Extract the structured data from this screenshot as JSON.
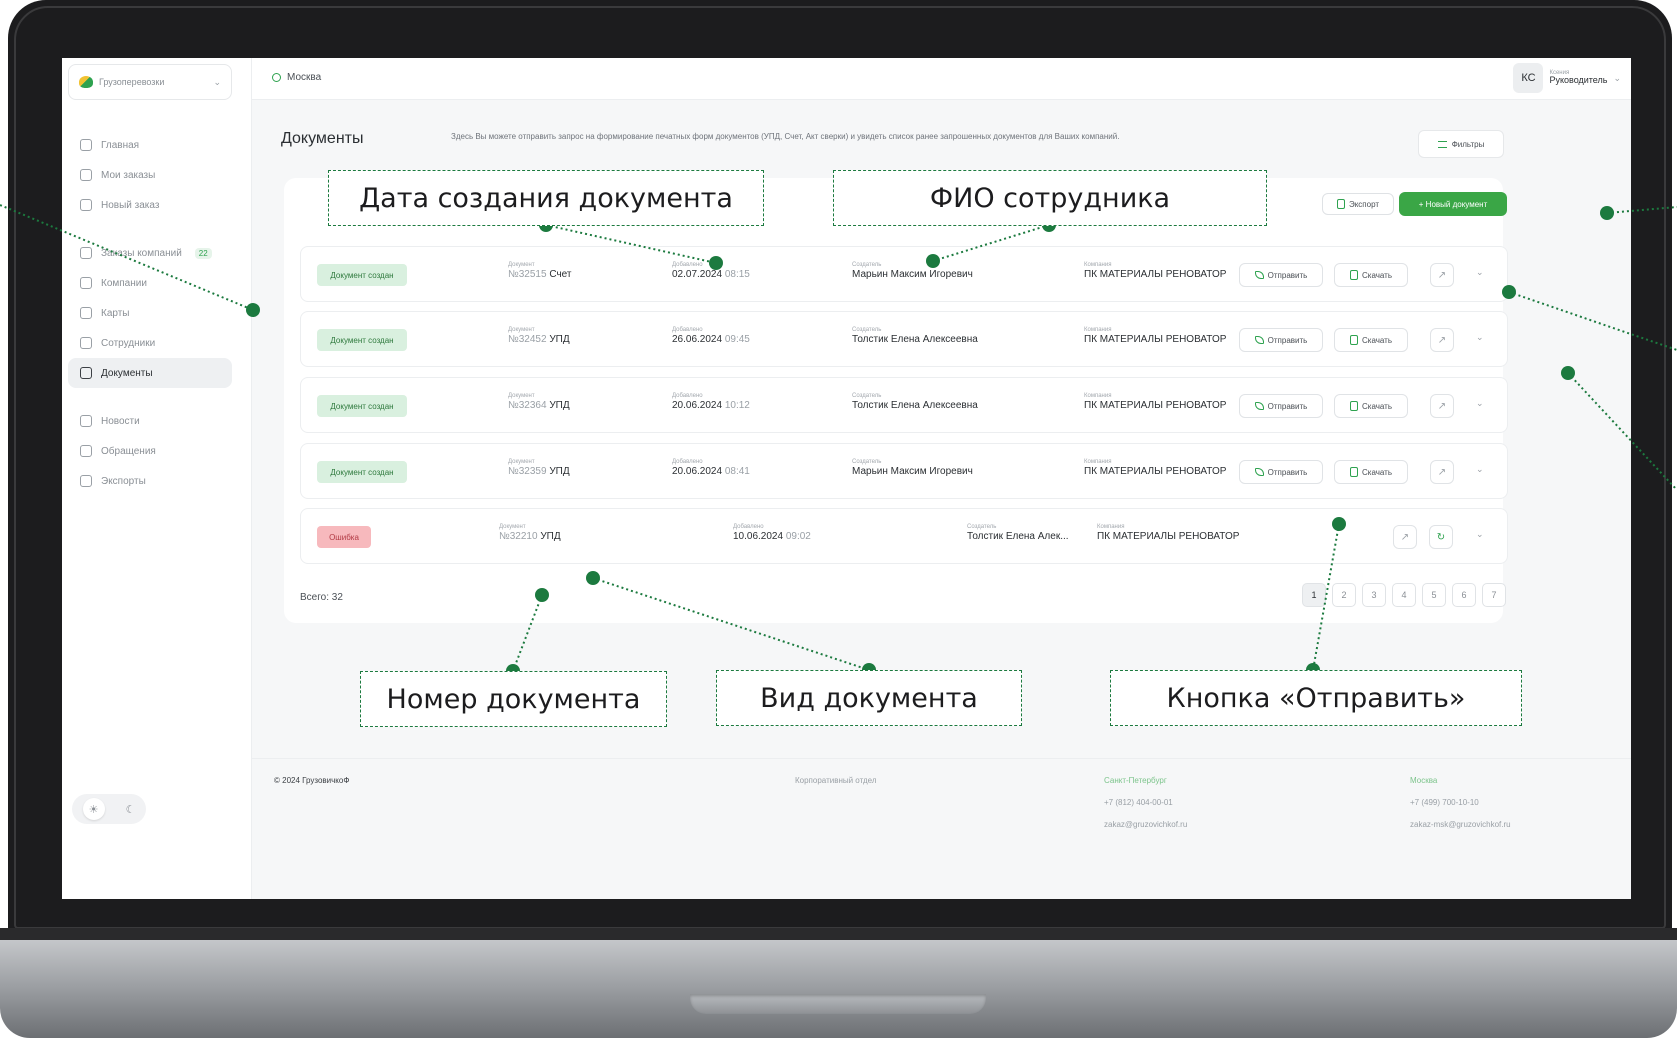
{
  "sidebar": {
    "company": "Грузоперевозки",
    "items": [
      {
        "label": "Главная",
        "icon": "home-icon"
      },
      {
        "label": "Мои заказы",
        "icon": "orders-icon"
      },
      {
        "label": "Новый заказ",
        "icon": "new-order-icon"
      },
      {
        "label": "Заказы компаний",
        "icon": "company-orders-icon",
        "badge": "22"
      },
      {
        "label": "Компании",
        "icon": "companies-icon"
      },
      {
        "label": "Карты",
        "icon": "cards-icon"
      },
      {
        "label": "Сотрудники",
        "icon": "employees-icon"
      },
      {
        "label": "Документы",
        "icon": "documents-icon",
        "active": true
      },
      {
        "label": "Новости",
        "icon": "news-icon"
      },
      {
        "label": "Обращения",
        "icon": "appeals-icon"
      },
      {
        "label": "Экспорты",
        "icon": "exports-icon"
      }
    ],
    "theme": {
      "light": "☀",
      "dark": "☾"
    }
  },
  "topbar": {
    "city": "Москва",
    "user_initials": "КС",
    "user_name": "Ксения",
    "user_role": "Руководитель"
  },
  "page": {
    "title": "Документы",
    "description": "Здесь Вы можете отправить запрос на формирование печатных форм документов (УПД, Счет, Акт сверки) и увидеть список ранее запрошенных документов для Ваших компаний.",
    "filters_label": "Фильтры",
    "export_label": "Экспорт",
    "new_doc_label": "+ Новый документ"
  },
  "labels": {
    "document": "Документ",
    "added": "Добавлено",
    "creator": "Создатель",
    "company": "Компания",
    "send": "Отправить",
    "download": "Скачать"
  },
  "rows": [
    {
      "status": "Документ создан",
      "status_type": "ok",
      "number": "№32515",
      "type": "Счет",
      "date": "02.07.2024",
      "time": "08:15",
      "creator": "Марьин Максим Игоревич",
      "company": "ПК МАТЕРИАЛЫ РЕНОВАТОР"
    },
    {
      "status": "Документ создан",
      "status_type": "ok",
      "number": "№32452",
      "type": "УПД",
      "date": "26.06.2024",
      "time": "09:45",
      "creator": "Толстик Елена Алексеевна",
      "company": "ПК МАТЕРИАЛЫ РЕНОВАТОР"
    },
    {
      "status": "Документ создан",
      "status_type": "ok",
      "number": "№32364",
      "type": "УПД",
      "date": "20.06.2024",
      "time": "10:12",
      "creator": "Толстик Елена Алексеевна",
      "company": "ПК МАТЕРИАЛЫ РЕНОВАТОР"
    },
    {
      "status": "Документ создан",
      "status_type": "ok",
      "number": "№32359",
      "type": "УПД",
      "date": "20.06.2024",
      "time": "08:41",
      "creator": "Марьин Максим Игоревич",
      "company": "ПК МАТЕРИАЛЫ РЕНОВАТОР"
    },
    {
      "status": "Ошибка",
      "status_type": "err",
      "number": "№32210",
      "type": "УПД",
      "date": "10.06.2024",
      "time": "09:02",
      "creator": "Толстик Елена Алек...",
      "company": "ПК МАТЕРИАЛЫ РЕНОВАТОР"
    }
  ],
  "total": {
    "label": "Всего:",
    "value": "32"
  },
  "pagination": [
    "1",
    "2",
    "3",
    "4",
    "5",
    "6",
    "7"
  ],
  "current_page": "1",
  "footer": {
    "copyright": "© 2024 ГрузовичкоФ",
    "department": "Корпоративный отдел",
    "spb_city": "Санкт-Петербург",
    "spb_phone": "+7 (812) 404-00-01",
    "spb_email": "zakaz@gruzovichkof.ru",
    "msk_city": "Москва",
    "msk_phone": "+7 (499) 700-10-10",
    "msk_email": "zakaz-msk@gruzovichkof.ru"
  },
  "annotations": {
    "date_created": "Дата создания документа",
    "employee_name": "ФИО сотрудника",
    "doc_number": "Номер документа",
    "doc_type": "Вид документа",
    "send_button": "Кнопка «Отправить»"
  },
  "colors": {
    "accent": "#3aa646",
    "annotation": "#1c7a3f",
    "status_ok_bg": "#d9f0df",
    "status_err_bg": "#f7b9bd"
  }
}
